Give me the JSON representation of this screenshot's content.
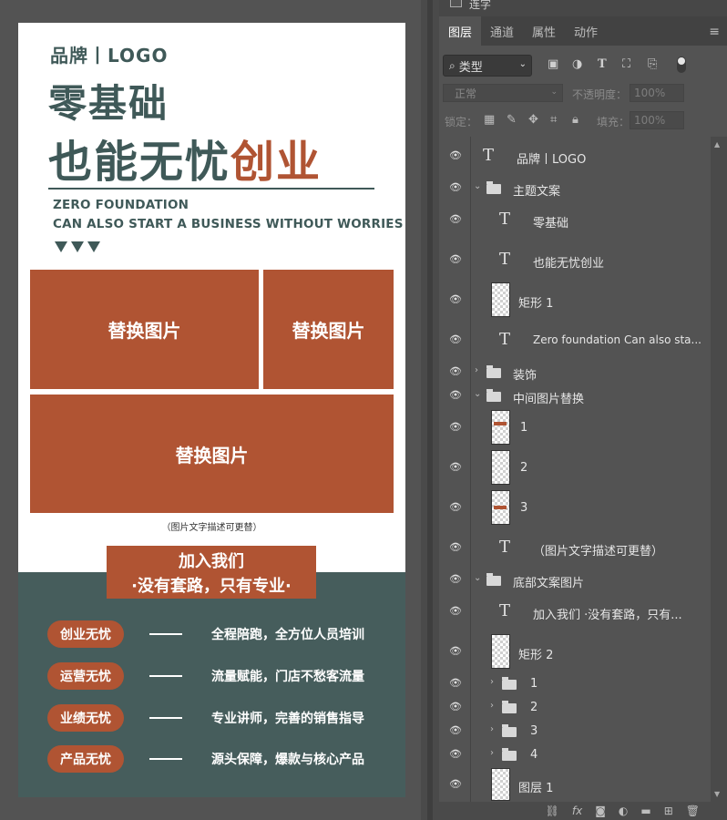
{
  "poster": {
    "brand": "品牌丨LOGO",
    "title_line1": "零基础",
    "title_line2_a": "也能无忧",
    "title_line2_b": "创业",
    "en_line1": "ZERO FOUNDATION",
    "en_line2": "CAN ALSO START A BUSINESS WITHOUT WORRIES",
    "placeholder1": "替换图片",
    "placeholder2": "替换图片",
    "placeholder3": "替换图片",
    "caption": "（图片文字描述可更替）",
    "join_line1": "加入我们",
    "join_line2": "·没有套路，只有专业·",
    "features": [
      {
        "tag": "创业无忧",
        "text": "全程陪跑，全方位人员培训"
      },
      {
        "tag": "运营无忧",
        "text": "流量赋能，门店不愁客流量"
      },
      {
        "tag": "业绩无忧",
        "text": "专业讲师，完善的销售指导"
      },
      {
        "tag": "产品无忧",
        "text": "源头保障，爆款与核心产品"
      }
    ],
    "colors": {
      "accent": "#b05433",
      "dark": "#3f5958",
      "bottom_bg": "#465d5c"
    }
  },
  "panel": {
    "top_checkbox_label": "连字",
    "tabs": [
      "图层",
      "通道",
      "属性",
      "动作"
    ],
    "filter_label": "类型",
    "blend_mode": "正常",
    "opacity_label": "不透明度：",
    "opacity_value": "100%",
    "lock_label": "锁定：",
    "fill_label": "填充：",
    "fill_value": "100%",
    "layers": [
      "品牌丨LOGO",
      "主题文案",
      "零基础",
      "也能无忧创业",
      "矩形 1",
      "Zero foundation  Can also sta...",
      "装饰",
      "中间图片替换",
      "1",
      "2",
      "3",
      "（图片文字描述可更替）",
      "底部文案图片",
      "加入我们 ·没有套路，只有...",
      "矩形 2",
      "1",
      "2",
      "3",
      "4",
      "图层 1"
    ]
  }
}
